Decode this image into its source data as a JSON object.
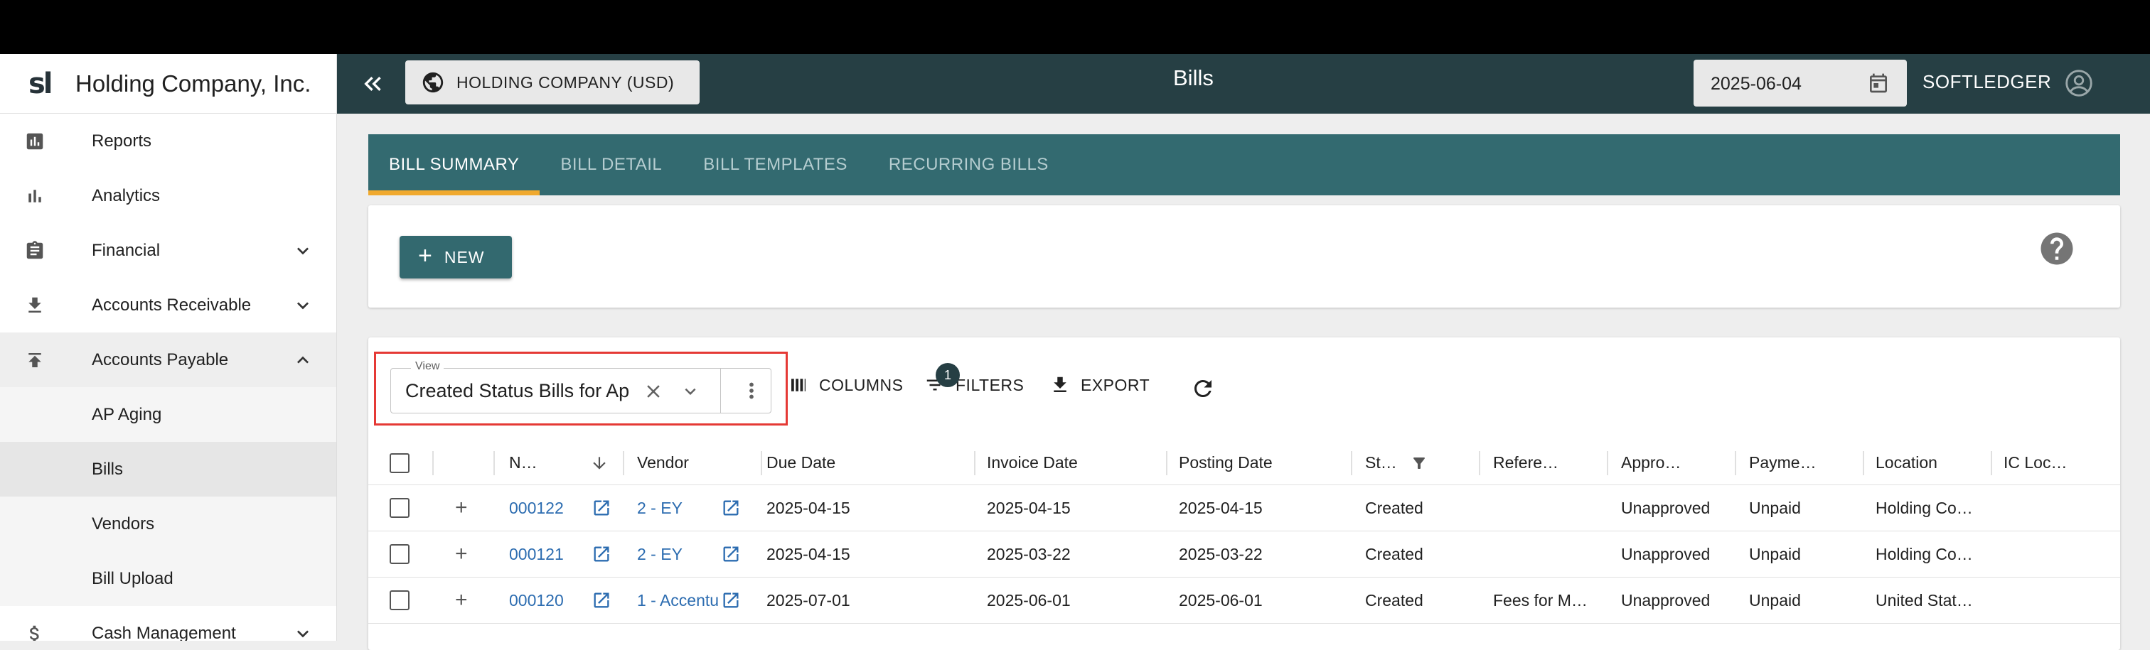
{
  "sidebar": {
    "brand_logo": "sl",
    "brand_name": "Holding Company, Inc.",
    "items": [
      {
        "label": "Reports",
        "icon": "reports-icon"
      },
      {
        "label": "Analytics",
        "icon": "analytics-icon"
      },
      {
        "label": "Financial",
        "icon": "clipboard-icon",
        "expandable": true
      },
      {
        "label": "Accounts Receivable",
        "icon": "download-icon",
        "expandable": true
      },
      {
        "label": "Accounts Payable",
        "icon": "upload-icon",
        "expanded": true
      },
      {
        "label": "Cash Management",
        "icon": "dollar-icon",
        "expandable": true
      }
    ],
    "ap_subitems": [
      "AP Aging",
      "Bills",
      "Vendors",
      "Bill Upload"
    ],
    "selected_subitem": "Bills"
  },
  "header": {
    "company": "HOLDING COMPANY (USD)",
    "title": "Bills",
    "date": "2025-06-04",
    "user": "SOFTLEDGER"
  },
  "tabs": [
    "BILL SUMMARY",
    "BILL DETAIL",
    "BILL TEMPLATES",
    "RECURRING BILLS"
  ],
  "active_tab": "BILL SUMMARY",
  "actions": {
    "new_label": "NEW"
  },
  "toolbar": {
    "view_label": "View",
    "view_value": "Created Status Bills for Ap",
    "columns_label": "COLUMNS",
    "filters_label": "FILTERS",
    "filters_count": "1",
    "export_label": "EXPORT"
  },
  "table": {
    "columns": [
      "N…",
      "Vendor",
      "Due Date",
      "Invoice Date",
      "Posting Date",
      "St…",
      "Refere…",
      "Appro…",
      "Payme…",
      "Location",
      "IC Loc…"
    ],
    "rows": [
      {
        "number": "000122",
        "vendor": "2 - EY",
        "due": "2025-04-15",
        "invoice": "2025-04-15",
        "posting": "2025-04-15",
        "status": "Created",
        "reference": "",
        "approval": "Unapproved",
        "payment": "Unpaid",
        "location": "Holding Co…",
        "ic_location": ""
      },
      {
        "number": "000121",
        "vendor": "2 - EY",
        "due": "2025-04-15",
        "invoice": "2025-03-22",
        "posting": "2025-03-22",
        "status": "Created",
        "reference": "",
        "approval": "Unapproved",
        "payment": "Unpaid",
        "location": "Holding Co…",
        "ic_location": ""
      },
      {
        "number": "000120",
        "vendor": "1 - Accentu",
        "due": "2025-07-01",
        "invoice": "2025-06-01",
        "posting": "2025-06-01",
        "status": "Created",
        "reference": "Fees for M…",
        "approval": "Unapproved",
        "payment": "Unpaid",
        "location": "United Stat…",
        "ic_location": ""
      }
    ]
  },
  "colors": {
    "header_bg": "#263f44",
    "tabs_bg": "#336a70",
    "tab_indicator": "#f0a92e",
    "link": "#2c6cb0",
    "highlight_box": "#e53935"
  }
}
